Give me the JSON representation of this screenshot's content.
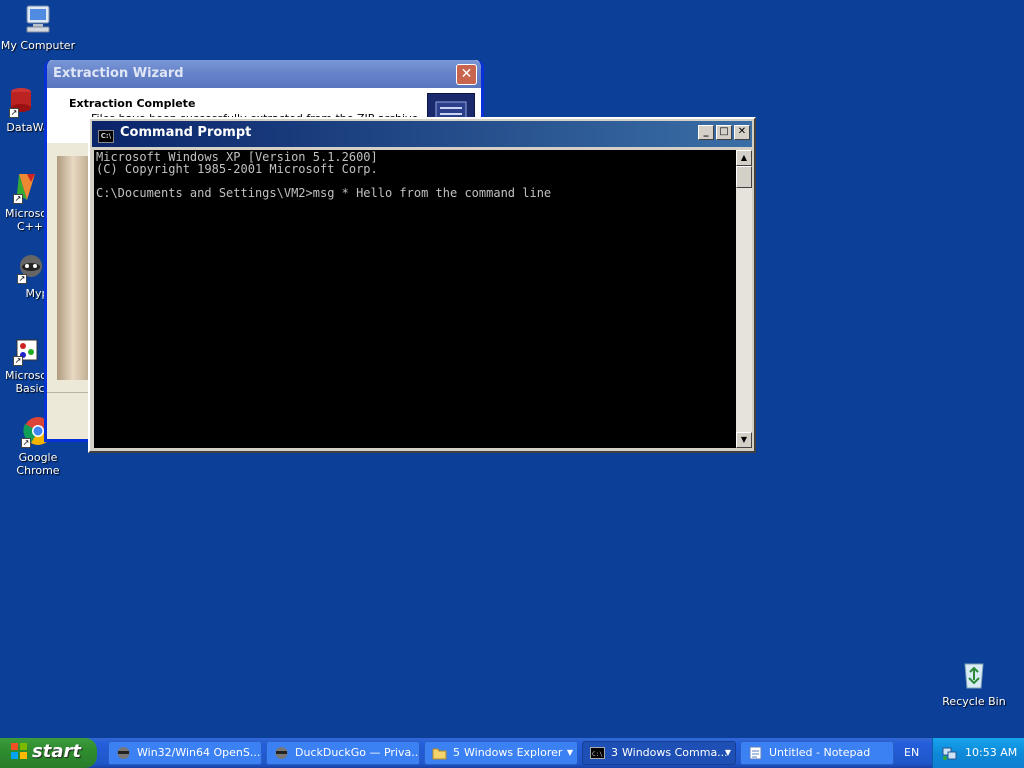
{
  "desktop": {
    "icons": [
      {
        "label": "My Computer"
      },
      {
        "label": "DataWa"
      },
      {
        "label": "Microsoft C++"
      },
      {
        "label": "Myp"
      },
      {
        "label": "Microsoft Basic"
      },
      {
        "label": "Google Chrome"
      },
      {
        "label": "Recycle Bin"
      }
    ]
  },
  "wizard": {
    "title": "Extraction Wizard",
    "close_label": "✕",
    "header_title": "Extraction Complete",
    "header_subtitle": "Files have been successfully extracted from the ZIP archive."
  },
  "cmd": {
    "title": "Command Prompt",
    "icon_text": "C:\\",
    "minimize": "_",
    "maximize": "□",
    "close": "✕",
    "lines": [
      "Microsoft Windows XP [Version 5.1.2600]",
      "(C) Copyright 1985-2001 Microsoft Corp.",
      "",
      "C:\\Documents and Settings\\VM2>msg * Hello from the command line"
    ]
  },
  "taskbar": {
    "start_label": "start",
    "tasks": [
      {
        "label": "Win32/Win64 OpenS..."
      },
      {
        "label": "DuckDuckGo — Priva..."
      },
      {
        "count": "5",
        "label": "Windows Explorer"
      },
      {
        "count": "3",
        "label": "Windows Comma..."
      },
      {
        "label": "Untitled - Notepad"
      }
    ],
    "language": "EN",
    "clock": "10:53 AM"
  },
  "colors": {
    "desktop": "#0b3f98",
    "taskbar": "#245edb",
    "start": "#2f8d2f",
    "cmd_titlebar": "#0a246a",
    "wizard_titlebar": "#6783c9"
  }
}
